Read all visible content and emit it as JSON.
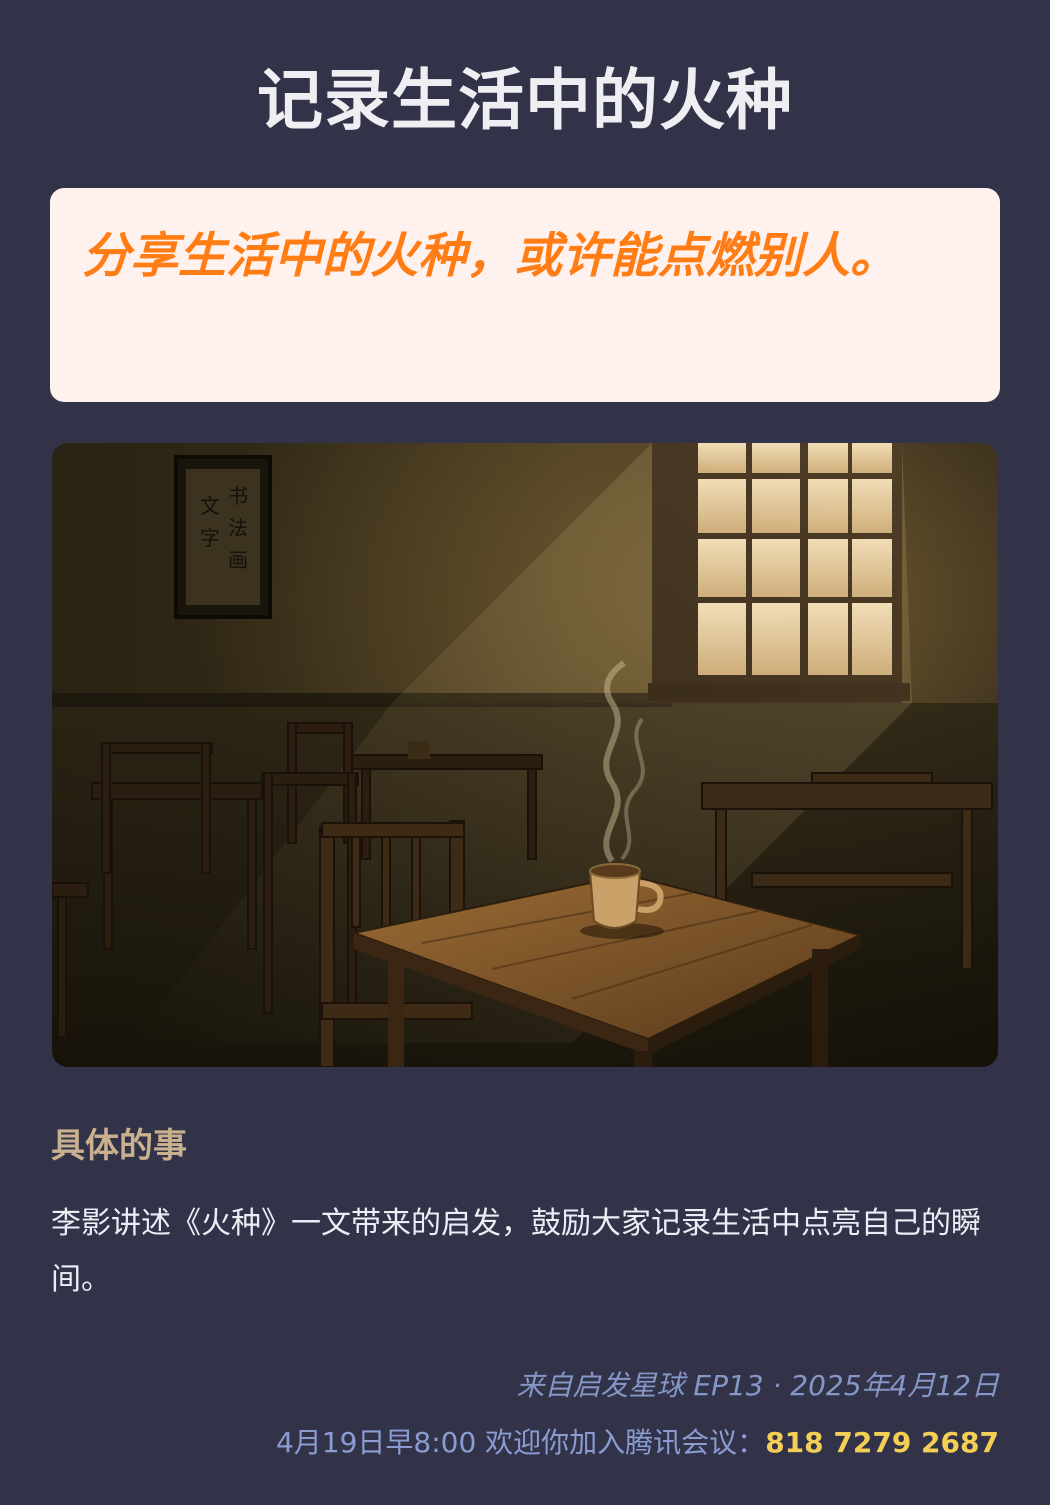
{
  "title": "记录生活中的火种",
  "quote": "分享生活中的火种，或许能点燃别人。",
  "section": {
    "heading": "具体的事",
    "body": "李影讲述《火种》一文带来的启发，鼓励大家记录生活中点亮自己的瞬间。"
  },
  "footer": {
    "source": "来自启发星球 EP13 · 2025年4月12日",
    "invite": "4月19日早8:00 欢迎你加入腾讯会议：",
    "meeting_id": "818 7279 2687"
  },
  "colors": {
    "background": "#323349",
    "quote_card": "#fff1ee",
    "quote_text": "#ff7d14",
    "heading": "#c9b08f",
    "meeting_id": "#f4cf56"
  }
}
